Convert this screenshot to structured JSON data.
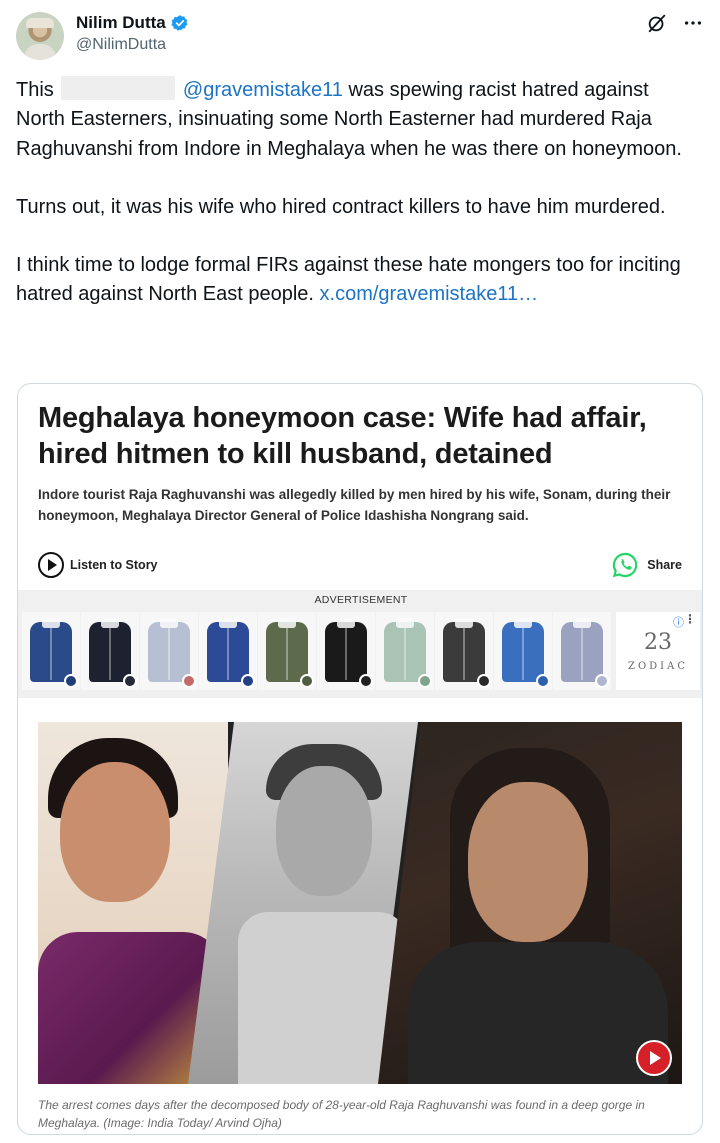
{
  "author": {
    "display_name": "Nilim Dutta",
    "handle": "@NilimDutta",
    "verified": true
  },
  "header_icons": [
    "grok-icon",
    "more-icon"
  ],
  "tweet": {
    "p1_before": "This",
    "p1_mention": "@gravemistake11",
    "p1_after": " was spewing racist hatred against North Easterners, insinuating some North Easterner had murdered Raja Raghuvanshi from Indore in Meghalaya when he was there on honeymoon.",
    "p2": "Turns out, it was his wife who hired contract killers to have him murdered.",
    "p3_text": "I think time to lodge formal FIRs against these hate mongers too for inciting hatred against North East people. ",
    "p3_link": "x.com/gravemistake11…"
  },
  "article": {
    "headline": "Meghalaya honeymoon case: Wife had affair, hired hitmen to kill husband, detained",
    "summary": "Indore tourist Raja Raghuvanshi was allegedly killed by men hired by his wife, Sonam, during their honeymoon, Meghalaya Director General of Police Idashisha Nongrang said.",
    "listen_label": "Listen to Story",
    "share_label": "Share",
    "ad_label": "ADVERTISEMENT",
    "ad_brand": "ZODIAC",
    "ad_brand_mark": "23",
    "caption": "The arrest comes days after the decomposed body of 28-year-old Raja Raghuvanshi was found in a deep gorge in Meghalaya. (Image: India Today/ Arvind Ojha)"
  },
  "ad_shirts": [
    {
      "color": "#2b4a8a",
      "swatch": "#1f3d7a"
    },
    {
      "color": "#1e2230",
      "swatch": "#262a36"
    },
    {
      "color": "#b7c0d3",
      "swatch": "#c46a6a"
    },
    {
      "color": "#2c4a96",
      "swatch": "#243f85"
    },
    {
      "color": "#5d6a4c",
      "swatch": "#4f5c40"
    },
    {
      "color": "#1a1a1a",
      "swatch": "#222222"
    },
    {
      "color": "#a9c4b4",
      "swatch": "#7fa38d"
    },
    {
      "color": "#3b3b3b",
      "swatch": "#2a2a2a"
    },
    {
      "color": "#3a6fbf",
      "swatch": "#2d5fac"
    },
    {
      "color": "#9aa2c0",
      "swatch": "#b0b6cf"
    }
  ],
  "colors": {
    "link": "#1d74c4",
    "verified": "#1d9bf0",
    "whatsapp": "#25d366",
    "video_play": "#d62027"
  }
}
